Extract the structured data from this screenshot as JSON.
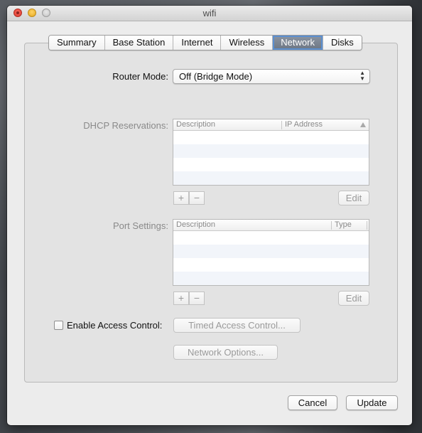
{
  "window": {
    "title": "wifi"
  },
  "tabs": [
    {
      "label": "Summary"
    },
    {
      "label": "Base Station"
    },
    {
      "label": "Internet"
    },
    {
      "label": "Wireless"
    },
    {
      "label": "Network",
      "active": true
    },
    {
      "label": "Disks"
    }
  ],
  "router_mode": {
    "label": "Router Mode:",
    "value": "Off (Bridge Mode)"
  },
  "dhcp": {
    "label": "DHCP Reservations:",
    "columns": [
      "Description",
      "IP Address"
    ],
    "rows": [],
    "add_label": "+",
    "remove_label": "−",
    "edit_label": "Edit"
  },
  "ports": {
    "label": "Port Settings:",
    "columns": [
      "Description",
      "Type"
    ],
    "rows": [],
    "add_label": "+",
    "remove_label": "−",
    "edit_label": "Edit"
  },
  "access_control": {
    "label": "Enable Access Control:",
    "checked": false,
    "timed_label": "Timed Access Control..."
  },
  "network_options_label": "Network Options...",
  "footer": {
    "cancel_label": "Cancel",
    "update_label": "Update"
  },
  "colors": {
    "active_tab": "#7a8290",
    "focus_ring": "#5b8fd0",
    "row_alt": "#f2f5fa"
  }
}
